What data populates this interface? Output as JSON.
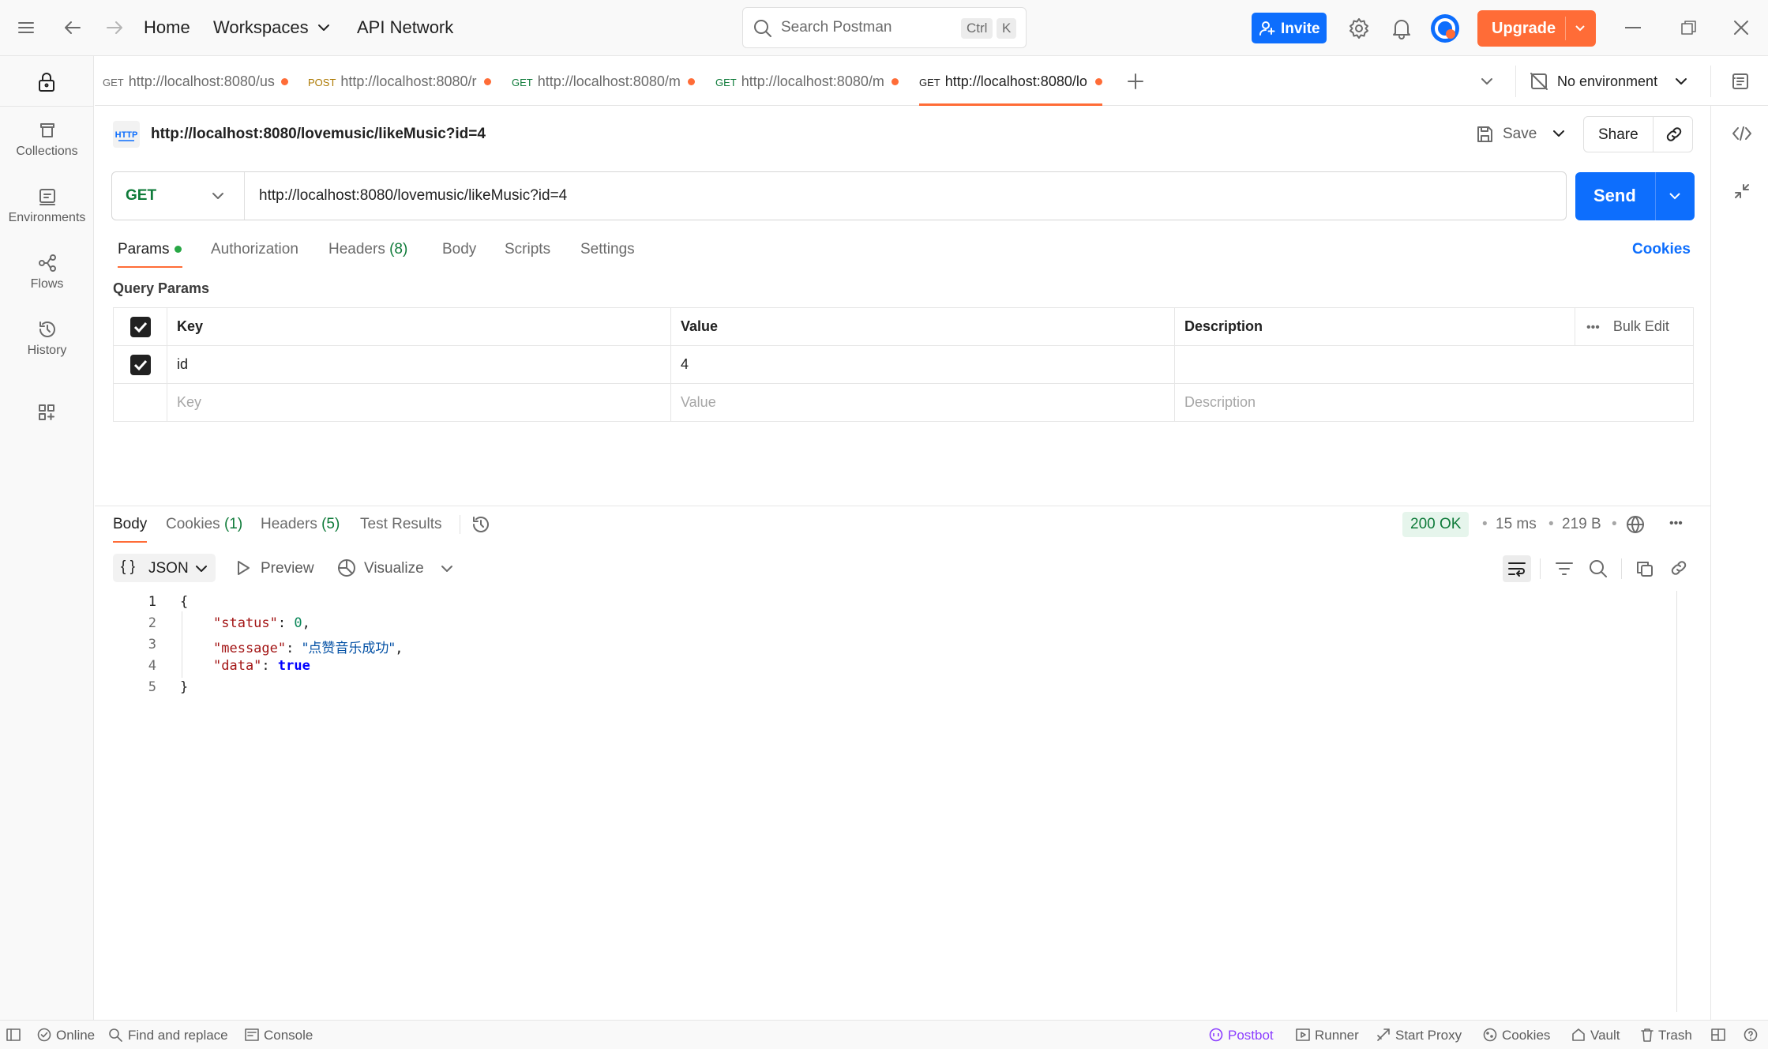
{
  "topbar": {
    "home": "Home",
    "workspaces": "Workspaces",
    "api_network": "API Network",
    "search_placeholder": "Search Postman",
    "kbd_ctrl": "Ctrl",
    "kbd_k": "K",
    "invite": "Invite",
    "upgrade": "Upgrade"
  },
  "sidebar": {
    "items": [
      {
        "label": "Collections",
        "icon": "collections-icon"
      },
      {
        "label": "Environments",
        "icon": "environments-icon"
      },
      {
        "label": "Flows",
        "icon": "flows-icon"
      },
      {
        "label": "History",
        "icon": "history-icon"
      }
    ]
  },
  "tabs": [
    {
      "method": "GET",
      "url": "http://localhost:8080/us",
      "method_color": "#0f7b3a",
      "active": false
    },
    {
      "method": "POST",
      "url": "http://localhost:8080/r",
      "method_color": "#ad7a03",
      "active": false
    },
    {
      "method": "GET",
      "url": "http://localhost:8080/m",
      "method_color": "#0f7b3a",
      "active": false
    },
    {
      "method": "GET",
      "url": "http://localhost:8080/m",
      "method_color": "#0f7b3a",
      "active": false
    },
    {
      "method": "GET",
      "url": "http://localhost:8080/lo",
      "method_color": "#0f7b3a",
      "active": true
    }
  ],
  "environment": "No environment",
  "request": {
    "title": "http://localhost:8080/lovemusic/likeMusic?id=4",
    "save": "Save",
    "share": "Share",
    "method": "GET",
    "url": "http://localhost:8080/lovemusic/likeMusic?id=4",
    "send": "Send",
    "tabs": {
      "params": "Params",
      "authorization": "Authorization",
      "headers": "Headers",
      "headers_count": "(8)",
      "body": "Body",
      "scripts": "Scripts",
      "settings": "Settings"
    },
    "cookies": "Cookies",
    "query_params_title": "Query Params",
    "columns": {
      "key": "Key",
      "value": "Value",
      "description": "Description"
    },
    "bulk_edit": "Bulk Edit",
    "params": [
      {
        "key": "id",
        "value": "4",
        "checked": true
      }
    ],
    "placeholders": {
      "key": "Key",
      "value": "Value",
      "description": "Description"
    }
  },
  "response": {
    "tabs": {
      "body": "Body",
      "cookies": "Cookies",
      "cookies_count": "(1)",
      "headers": "Headers",
      "headers_count": "(5)",
      "test_results": "Test Results"
    },
    "status": "200 OK",
    "time": "15 ms",
    "size": "219 B",
    "format": "JSON",
    "preview": "Preview",
    "visualize": "Visualize",
    "lines": [
      "1",
      "2",
      "3",
      "4",
      "5"
    ],
    "json": {
      "open": "{",
      "status_key": "\"status\"",
      "status_val": "0",
      "message_key": "\"message\"",
      "message_val": "\"点赞音乐成功\"",
      "data_key": "\"data\"",
      "data_val": "true",
      "close": "}"
    }
  },
  "statusbar": {
    "online": "Online",
    "find_replace": "Find and replace",
    "console": "Console",
    "postbot": "Postbot",
    "runner": "Runner",
    "start_proxy": "Start Proxy",
    "cookies": "Cookies",
    "vault": "Vault",
    "trash": "Trash"
  },
  "colors": {
    "accent": "#ff6c37",
    "primary": "#0d6efd",
    "get_method": "#0f7b3a",
    "status_ok_bg": "#e6f5ec",
    "status_ok_text": "#0f7b3a"
  }
}
